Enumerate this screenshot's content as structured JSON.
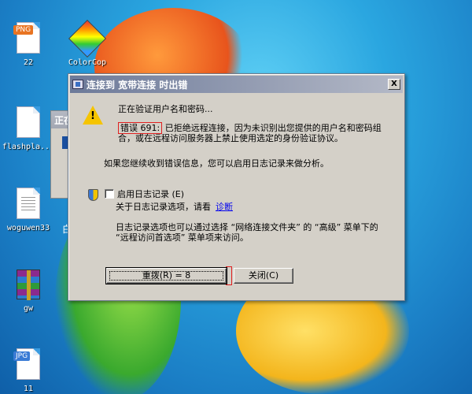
{
  "desktop": {
    "icons": [
      {
        "label": "22",
        "tag": "PNG",
        "icon": "png-file-icon"
      },
      {
        "label": "ColorCop",
        "icon": "colorcop-icon"
      },
      {
        "label": "flashpla...",
        "icon": "text-file-icon"
      },
      {
        "label": "woguwen33",
        "icon": "text-file-icon"
      },
      {
        "label": "gw",
        "icon": "winrar-archive-icon"
      },
      {
        "label": "11",
        "tag": "JPG",
        "icon": "jpg-file-icon"
      }
    ],
    "background_window_title": "正在",
    "partial_letter": "白",
    "colors": {
      "desktop_blue": "#1b7fc6"
    }
  },
  "dialog": {
    "title": "连接到 宽带连接 时出错",
    "close_glyph": "X",
    "verify_text": "正在验证用户名和密码...",
    "error_code": "错误 691:",
    "error_text": "已拒绝远程连接，因为未识别出您提供的用户名和密码组合，或在远程访问服务器上禁止使用选定的身份验证协议。",
    "continue_text": "如果您继续收到错误信息，您可以启用日志记录来做分析。",
    "enable_log_label": "启用日志记录 (E)",
    "log_about_text": "关于日志记录选项，请看",
    "diagnose_link": "诊断",
    "log_info_text": "日志记录选项也可以通过选择 “网络连接文件夹” 的 “高级” 菜单下的 “远程访问首选项” 菜单项来访问。",
    "redial_label": "重拨(R) = 8",
    "close_label": "关闭(C)",
    "colors": {
      "title_start": "#6d7a99",
      "title_end": "#b4b9c7",
      "highlight_red": "#e02020",
      "face": "#d4d0c8"
    }
  }
}
